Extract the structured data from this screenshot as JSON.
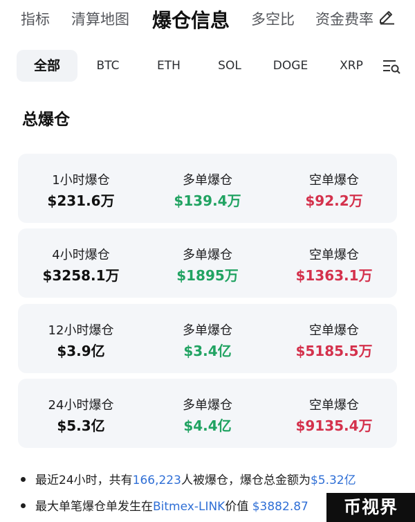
{
  "top_tabs": [
    "指标",
    "清算地图",
    "爆仓信息",
    "多空比",
    "资金费率"
  ],
  "active_top_tab": "爆仓信息",
  "coin_tabs": [
    "全部",
    "BTC",
    "ETH",
    "SOL",
    "DOGE",
    "XRP"
  ],
  "active_coin_tab": "全部",
  "section_title": "总爆仓",
  "cards": [
    {
      "period_label": "1小时爆仓",
      "total": "$231.6万",
      "long_label": "多单爆仓",
      "long": "$139.4万",
      "short_label": "空单爆仓",
      "short": "$92.2万"
    },
    {
      "period_label": "4小时爆仓",
      "total": "$3258.1万",
      "long_label": "多单爆仓",
      "long": "$1895万",
      "short_label": "空单爆仓",
      "short": "$1363.1万"
    },
    {
      "period_label": "12小时爆仓",
      "total": "$3.9亿",
      "long_label": "多单爆仓",
      "long": "$3.4亿",
      "short_label": "空单爆仓",
      "short": "$5185.5万"
    },
    {
      "period_label": "24小时爆仓",
      "total": "$5.3亿",
      "long_label": "多单爆仓",
      "long": "$4.4亿",
      "short_label": "空单爆仓",
      "short": "$9135.4万"
    }
  ],
  "summary": {
    "line1_prefix": "最近24小时，共有",
    "line1_count": "166,223",
    "line1_middle": "人被爆仓，爆仓总金额为",
    "line1_amount": "$5.32亿",
    "line2_prefix": "最大单笔爆仓单发生在",
    "line2_exchange": "Bitmex-LINK",
    "line2_middle": "价值 ",
    "line2_value": "$3882.87"
  },
  "watermark": "币视界",
  "colors": {
    "long": "#21a362",
    "short": "#d4314c",
    "highlight": "#2f6fd6"
  },
  "icons": {
    "edit": "pencil-edit-icon",
    "filter": "filter-search-icon"
  }
}
